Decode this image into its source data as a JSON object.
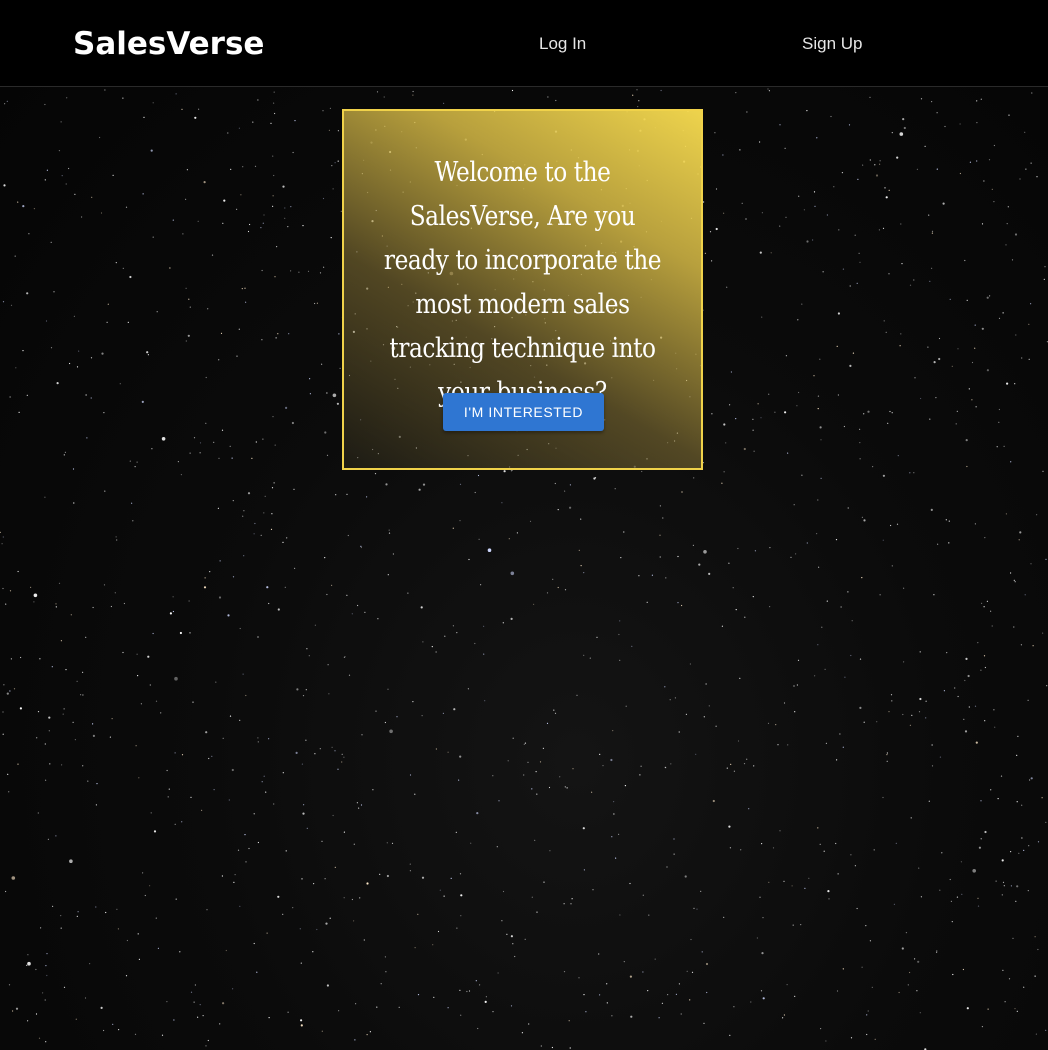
{
  "navbar": {
    "brand": "SalesVerse",
    "login_label": "Log In",
    "signup_label": "Sign Up"
  },
  "hero": {
    "heading": "Welcome to the SalesVerse, Are you ready to incorporate the most modern sales tracking technique into your business?",
    "button_label": "I'M INTERESTED"
  },
  "colors": {
    "navbar_bg": "#000000",
    "card_border": "#f0d24a",
    "card_gold": "#fade50",
    "button_bg": "#2f76d2",
    "background": "#0b0b0b"
  }
}
